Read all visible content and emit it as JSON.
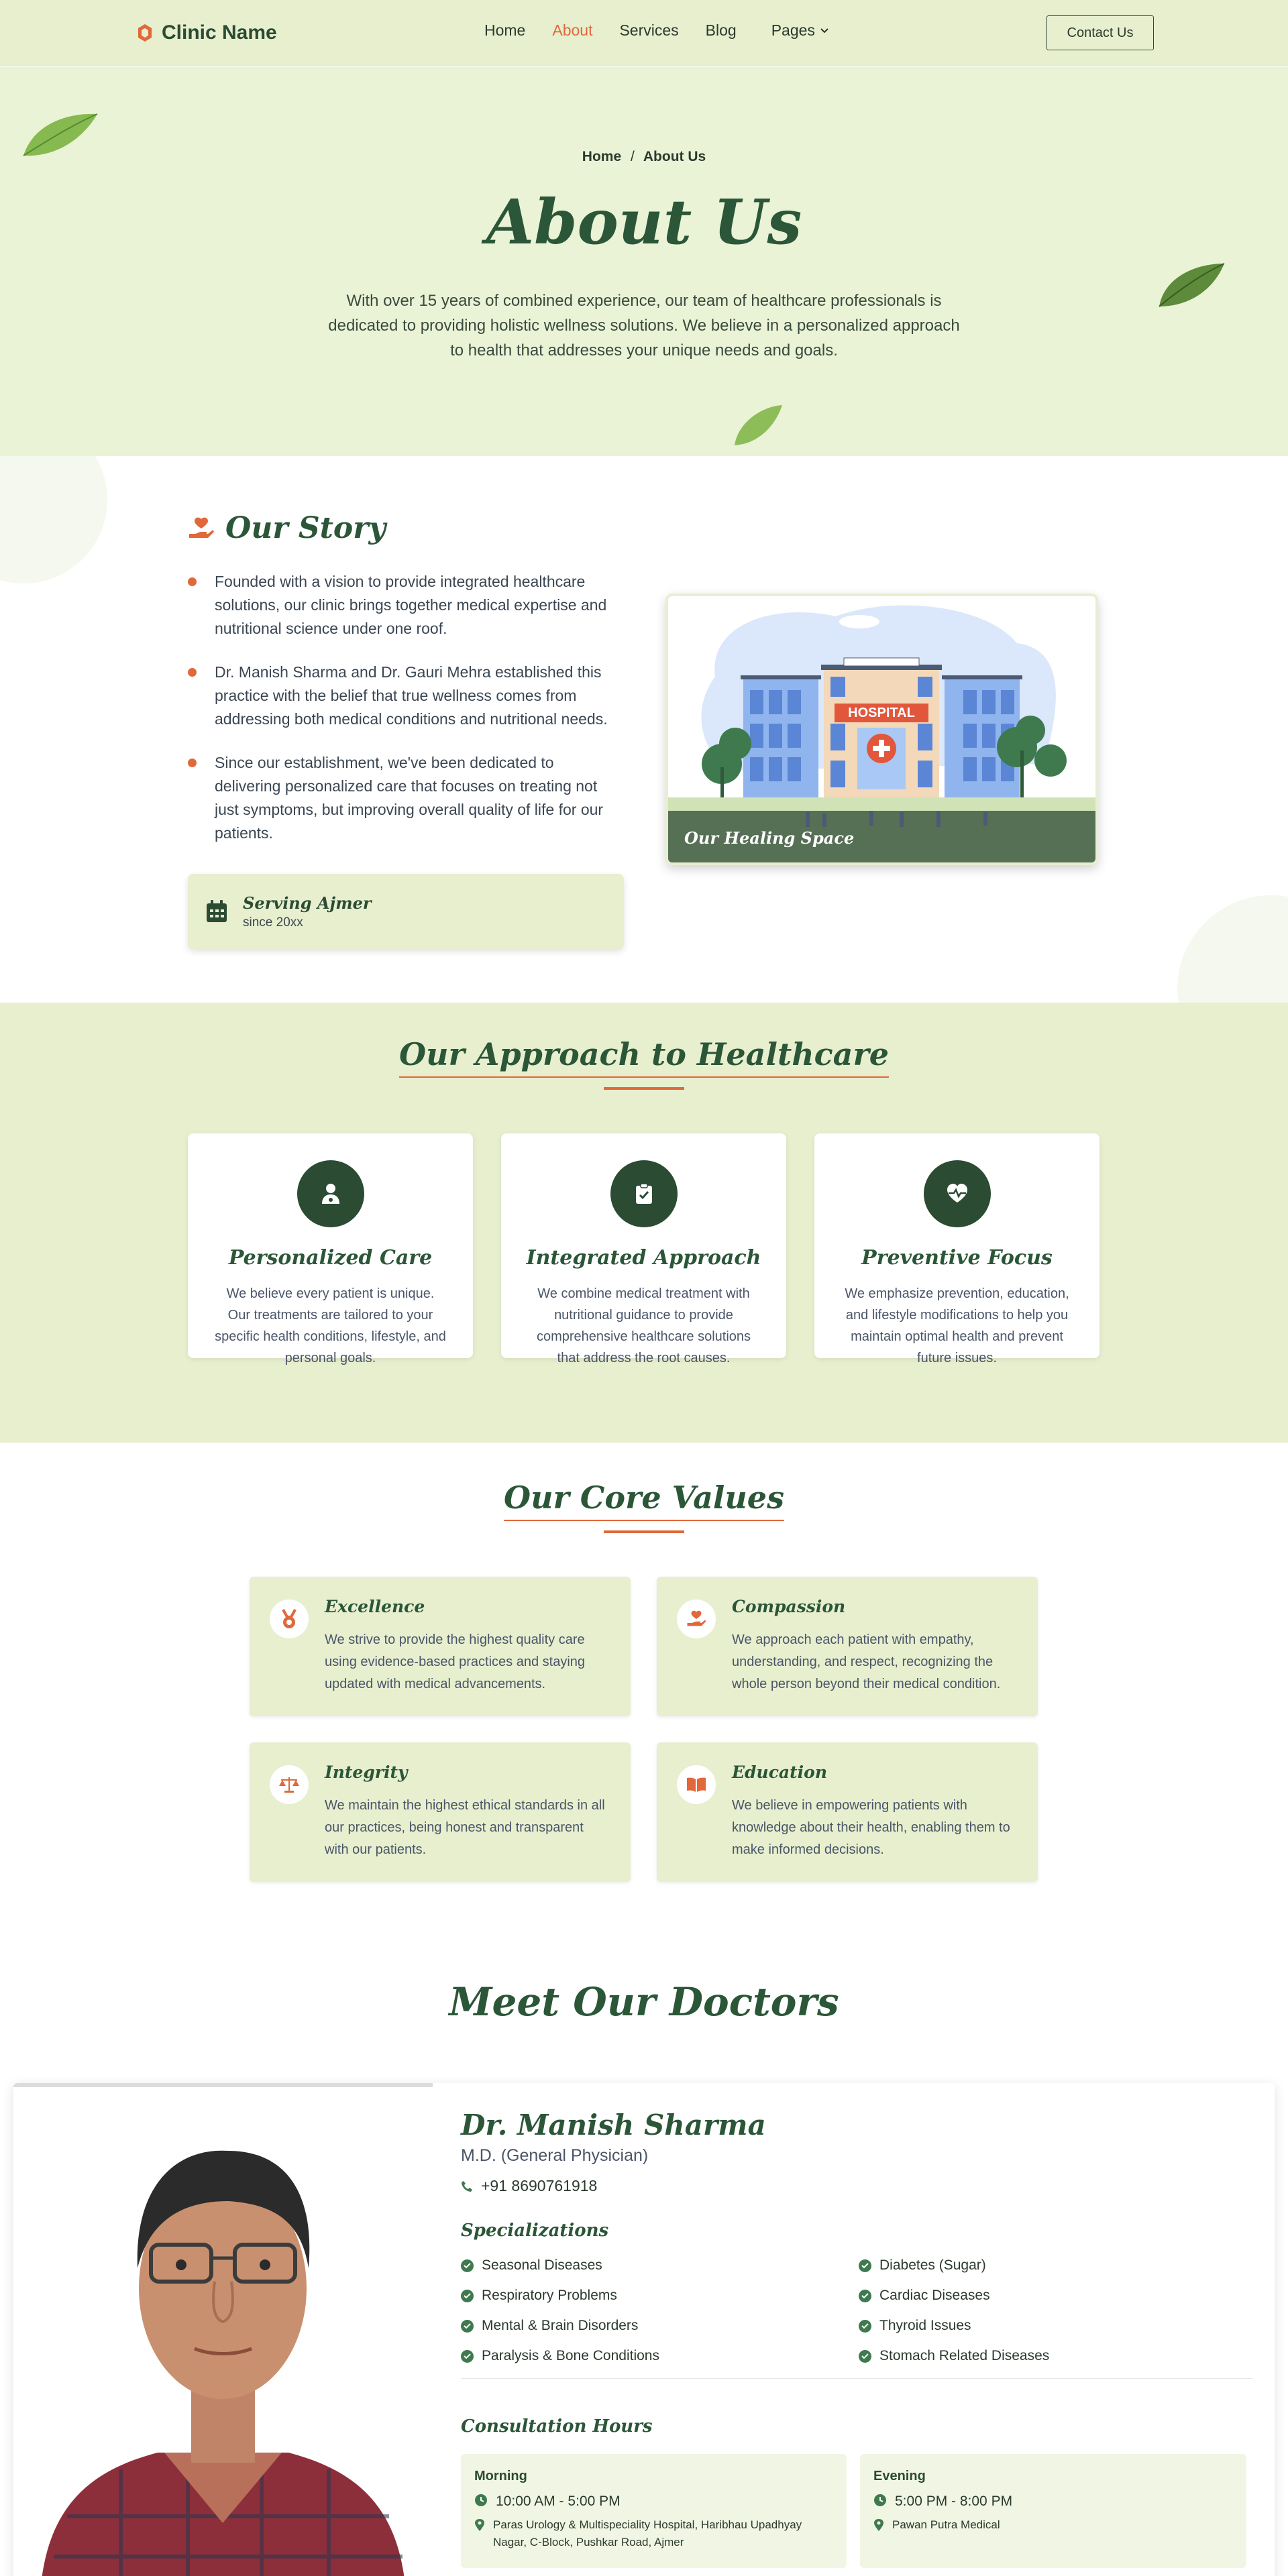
{
  "nav": {
    "brand": "Clinic Name",
    "items": [
      {
        "label": "Home"
      },
      {
        "label": "About"
      },
      {
        "label": "Services"
      },
      {
        "label": "Blog"
      },
      {
        "label": "Pages"
      }
    ],
    "contact_label": "Contact Us",
    "colors": {
      "accent": "#e0683a",
      "primary": "#2b5638",
      "background": "#e7efcf"
    }
  },
  "hero": {
    "breadcrumb_home": "Home",
    "breadcrumb_sep": "/",
    "breadcrumb_current": "About Us",
    "title": "About Us",
    "description": "With over 15 years of combined experience, our team of healthcare professionals is dedicated to providing holistic wellness solutions. We believe in a personalized approach to health that addresses your unique needs and goals."
  },
  "story": {
    "title": "Our Story",
    "points": [
      "Founded with a vision to provide integrated healthcare solutions, our clinic brings together medical expertise and nutritional science under one roof.",
      "Dr. Manish Sharma and Dr. Gauri Mehra established this practice with the belief that true wellness comes from addressing both medical conditions and nutritional needs.",
      "Since our establishment, we've been dedicated to delivering personalized care that focuses on treating not just symptoms, but improving overall quality of life for our patients."
    ],
    "serving_title": "Serving Ajmer",
    "serving_sub": "since 20xx",
    "image_sign": "HOSPITAL",
    "image_caption": "Our Healing Space"
  },
  "approach": {
    "title": "Our Approach to Healthcare",
    "cards": [
      {
        "title": "Personalized Care",
        "text": "We believe every patient is unique. Our treatments are tailored to your specific health conditions, lifestyle, and personal goals.",
        "icon": "user-doctor-icon"
      },
      {
        "title": "Integrated Approach",
        "text": "We combine medical treatment with nutritional guidance to provide comprehensive healthcare solutions that address the root causes.",
        "icon": "clipboard-check-icon"
      },
      {
        "title": "Preventive Focus",
        "text": "We emphasize prevention, education, and lifestyle modifications to help you maintain optimal health and prevent future issues.",
        "icon": "heart-pulse-icon"
      }
    ]
  },
  "values": {
    "title": "Our Core Values",
    "items": [
      {
        "title": "Excellence",
        "text": "We strive to provide the highest quality care using evidence-based practices and staying updated with medical advancements.",
        "icon": "medal-icon"
      },
      {
        "title": "Compassion",
        "text": "We approach each patient with empathy, understanding, and respect, recognizing the whole person beyond their medical condition.",
        "icon": "hand-heart-icon"
      },
      {
        "title": "Integrity",
        "text": "We maintain the highest ethical standards in all our practices, being honest and transparent with our patients.",
        "icon": "scale-icon"
      },
      {
        "title": "Education",
        "text": "We believe in empowering patients with knowledge about their health, enabling them to make informed decisions.",
        "icon": "book-icon"
      }
    ]
  },
  "doctors": {
    "title": "Meet Our Doctors",
    "doctor": {
      "name": "Dr. Manish Sharma",
      "degree": "M.D. (General Physician)",
      "phone": "+91 8690761918",
      "spec_title": "Specializations",
      "specializations": [
        "Seasonal Diseases",
        "Respiratory Problems",
        "Mental & Brain Disorders",
        "Paralysis & Bone Conditions",
        "Diabetes (Sugar)",
        "Cardiac Diseases",
        "Thyroid Issues",
        "Stomach Related Diseases"
      ],
      "hours_title": "Consultation Hours",
      "morning": {
        "label": "Morning",
        "time": "10:00 AM - 5:00 PM",
        "place": "Paras Urology & Multispeciality Hospital, Haribhau Upadhyay Nagar, C-Block, Pushkar Road, Ajmer"
      },
      "evening": {
        "label": "Evening",
        "time": "5:00 PM - 8:00 PM",
        "place": "Pawan Putra Medical"
      }
    }
  }
}
